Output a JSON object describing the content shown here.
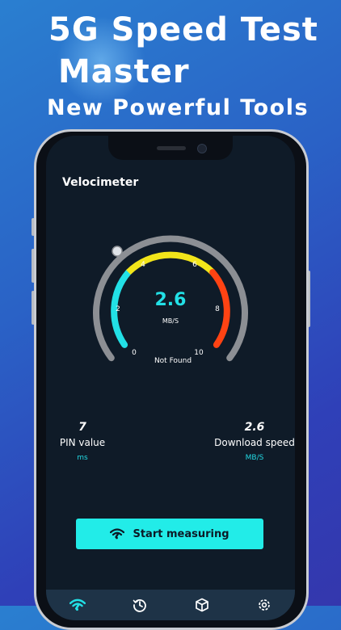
{
  "promo": {
    "title_line1": "5G Speed Test",
    "title_line2": "Master",
    "subtitle": "New Powerful Tools"
  },
  "screen": {
    "title": "Velocimeter",
    "gauge": {
      "value": "2.6",
      "unit": "MB/S",
      "status": "Not Found",
      "ticks": [
        "0",
        "2",
        "4",
        "6",
        "8",
        "10"
      ],
      "colors": {
        "cyan": "#22e0e6",
        "yellow": "#f2e51a",
        "red": "#ff4313",
        "track": "#8c8f94"
      }
    },
    "stats": {
      "pin": {
        "value": "7",
        "label": "PIN value",
        "unit": "ms"
      },
      "download": {
        "value": "2.6",
        "label": "Download speed",
        "unit": "MB/S"
      }
    },
    "start_button": "Start measuring",
    "tabs": [
      "wifi-icon",
      "history-icon",
      "cube-icon",
      "settings-icon"
    ]
  }
}
